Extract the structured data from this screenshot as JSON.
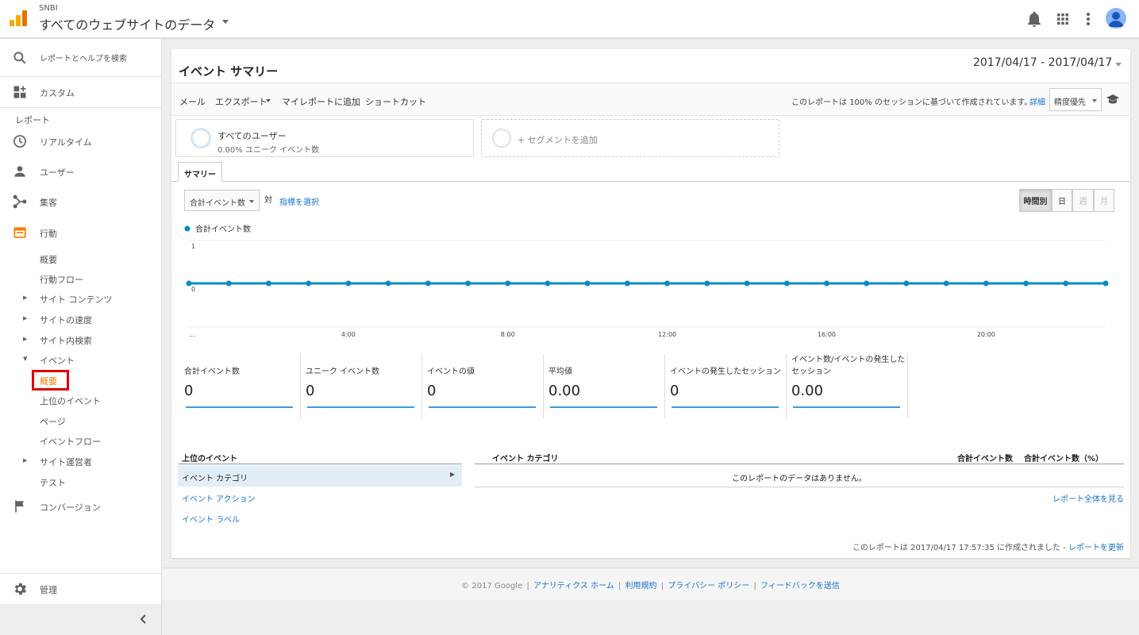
{
  "header": {
    "account": "SNBI",
    "property": "すべてのウェブサイトのデータ"
  },
  "colors": {
    "accent_orange": "#F57C00",
    "link_blue": "#1A73C8",
    "series_blue": "#058DC7",
    "highlight_red": "#E00000"
  },
  "sidebar": {
    "search_placeholder": "レポートとヘルプを検索",
    "custom": "カスタム",
    "reports_heading": "レポート",
    "realtime": "リアルタイム",
    "users": "ユーザー",
    "acquisition": "集客",
    "behavior": "行動",
    "behavior_items": {
      "overview": "概要",
      "behavior_flow": "行動フロー",
      "site_content": "サイト コンテンツ",
      "site_speed": "サイトの速度",
      "site_search": "サイト内検索",
      "events": "イベント",
      "events_overview": "概要",
      "top_events": "上位のイベント",
      "pages": "ページ",
      "events_flow": "イベントフロー",
      "publisher": "サイト運営者",
      "experiments": "テスト"
    },
    "conversions": "コンバージョン",
    "admin": "管理"
  },
  "report": {
    "title": "イベント サマリー",
    "date_range": "2017/04/17 - 2017/04/17",
    "toolbar": {
      "email": "メール",
      "export": "エクスポート",
      "add_to_dashboard": "マイレポートに追加",
      "shortcut": "ショートカット"
    },
    "sampling_text": "このレポートは 100% のセッションに基づいて作成されています。",
    "sampling_link": "詳細",
    "precision": "精度優先",
    "segments": {
      "all_users": "すべてのユーザー",
      "all_users_sub": "0.00% ユニーク イベント数",
      "add_segment": "+ セグメントを追加"
    },
    "tab": "サマリー",
    "metric_select": "合計イベント数",
    "vs": "対",
    "select_metric": "指標を選択",
    "granularity": {
      "hourly": "時間別",
      "day": "日",
      "week": "週",
      "month": "月"
    }
  },
  "chart_data": {
    "type": "line",
    "series": [
      {
        "name": "合計イベント数",
        "values": [
          0,
          0,
          0,
          0,
          0,
          0,
          0,
          0,
          0,
          0,
          0,
          0,
          0,
          0,
          0,
          0,
          0,
          0,
          0,
          0,
          0,
          0,
          0,
          0
        ]
      }
    ],
    "x_ticks": [
      "...",
      "4:00",
      "8:00",
      "12:00",
      "16:00",
      "20:00"
    ],
    "y_ticks": [
      "1",
      "0"
    ],
    "ylim": [
      0,
      1
    ]
  },
  "scorecards": [
    {
      "label": "合計イベント数",
      "value": "0"
    },
    {
      "label": "ユニーク イベント数",
      "value": "0"
    },
    {
      "label": "イベントの値",
      "value": "0"
    },
    {
      "label": "平均値",
      "value": "0.00"
    },
    {
      "label": "イベントの発生したセッション",
      "value": "0"
    },
    {
      "label": "イベント数/イベントの発生したセッション",
      "value": "0.00"
    }
  ],
  "table": {
    "top_events": "上位のイベント",
    "dimensions": {
      "category": "イベント カテゴリ",
      "action": "イベント アクション",
      "label": "イベント ラベル"
    },
    "columns": {
      "category": "イベント カテゴリ",
      "total": "合計イベント数",
      "total_pct": "合計イベント数（%）"
    },
    "no_data": "このレポートのデータはありません。",
    "full_report": "レポート全体を見る",
    "generated_text": "このレポートは 2017/04/17 17:57:35 に作成されました - ",
    "refresh": "レポートを更新"
  },
  "footer": {
    "copyright": "© 2017 Google",
    "home": "アナリティクス ホーム",
    "terms": "利用規約",
    "privacy": "プライバシー ポリシー",
    "feedback": "フィードバックを送信",
    "sep": "|"
  }
}
